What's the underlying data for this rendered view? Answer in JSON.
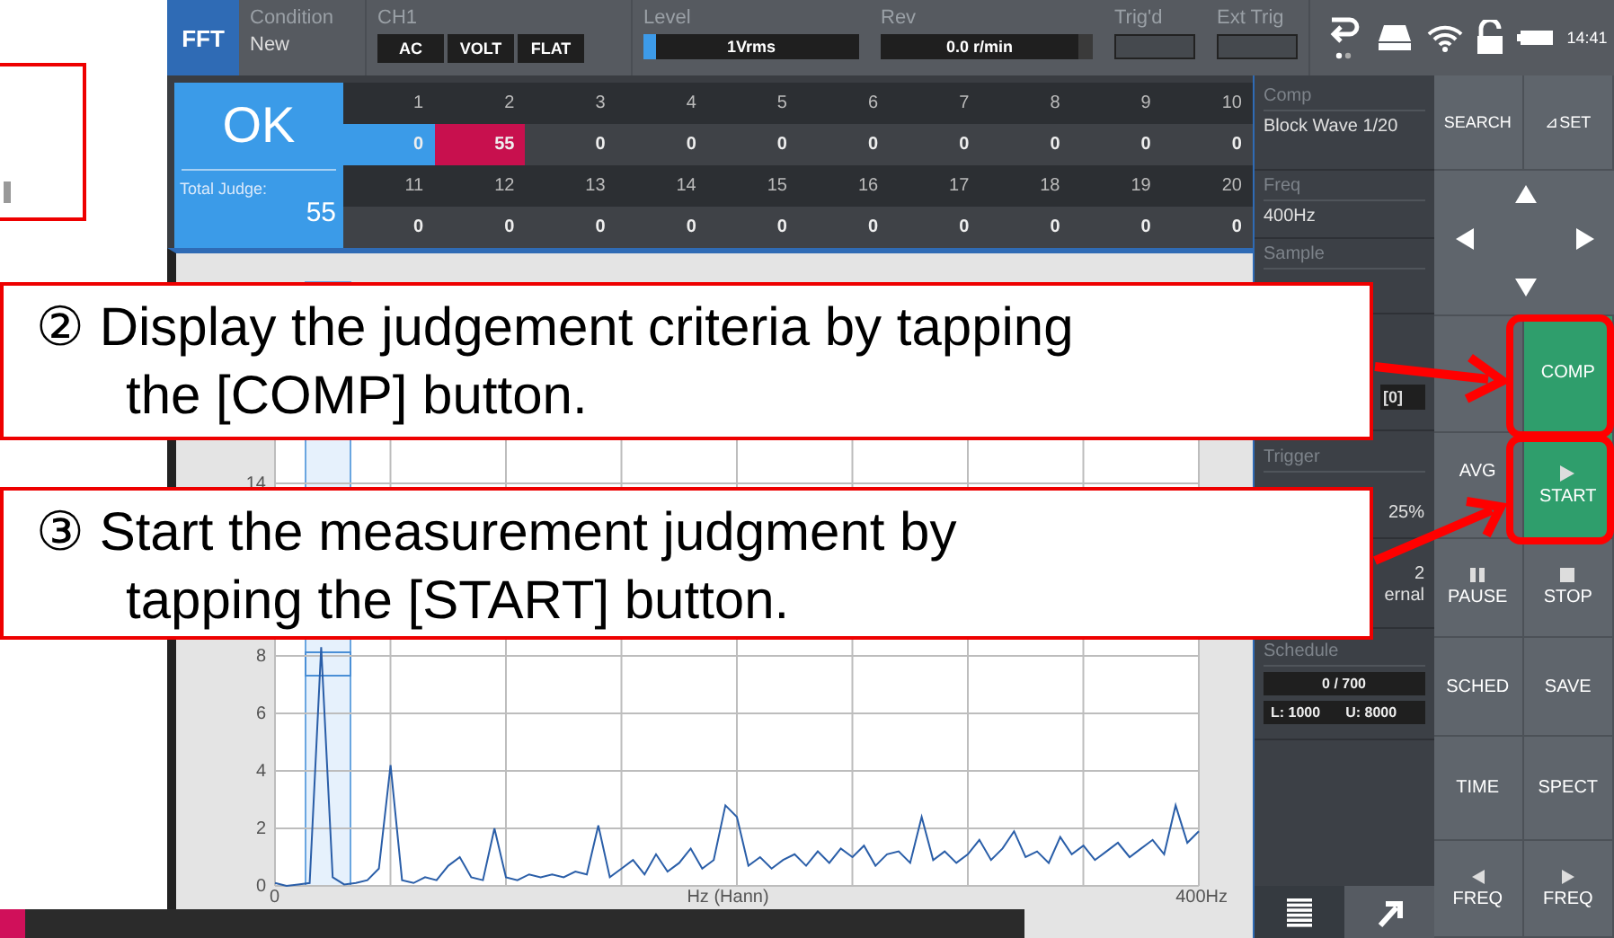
{
  "topbar": {
    "mode": "FFT",
    "condition_label": "Condition",
    "condition_value": "New",
    "channel_label": "CH1",
    "channel_settings": [
      "AC",
      "VOLT",
      "FLAT"
    ],
    "level_label": "Level",
    "level_value": "1Vrms",
    "level_meter": {
      "level": 0.06
    },
    "rev_label": "Rev",
    "rev_value": "0.0 r/min",
    "trigd_label": "Trig'd",
    "ext_trig_label": "Ext Trig",
    "time": "14:41"
  },
  "judge": {
    "result": "OK",
    "total_label": "Total Judge:",
    "total_value": "55",
    "blocks": [
      {
        "number": "1",
        "count": "0",
        "color": "#3b9be8"
      },
      {
        "number": "2",
        "count": "55",
        "color": "#c8104e"
      },
      {
        "number": "3",
        "count": "0",
        "color": "#3f4247"
      },
      {
        "number": "4",
        "count": "0",
        "color": "#3f4247"
      },
      {
        "number": "5",
        "count": "0",
        "color": "#3f4247"
      },
      {
        "number": "6",
        "count": "0",
        "color": "#3f4247"
      },
      {
        "number": "7",
        "count": "0",
        "color": "#3f4247"
      },
      {
        "number": "8",
        "count": "0",
        "color": "#3f4247"
      },
      {
        "number": "9",
        "count": "0",
        "color": "#3f4247"
      },
      {
        "number": "10",
        "count": "0",
        "color": "#3f4247"
      },
      {
        "number": "11",
        "count": "0",
        "color": "#3f4247"
      },
      {
        "number": "12",
        "count": "0",
        "color": "#3f4247"
      },
      {
        "number": "13",
        "count": "0",
        "color": "#3f4247"
      },
      {
        "number": "14",
        "count": "0",
        "color": "#3f4247"
      },
      {
        "number": "15",
        "count": "0",
        "color": "#3f4247"
      },
      {
        "number": "16",
        "count": "0",
        "color": "#3f4247"
      },
      {
        "number": "17",
        "count": "0",
        "color": "#3f4247"
      },
      {
        "number": "18",
        "count": "0",
        "color": "#3f4247"
      },
      {
        "number": "19",
        "count": "0",
        "color": "#3f4247"
      },
      {
        "number": "20",
        "count": "0",
        "color": "#3f4247"
      }
    ]
  },
  "spectrum": {
    "chart_data": {
      "type": "line",
      "xlabel": "Hz (Hann)",
      "xlim": [
        0,
        400
      ],
      "ylim": [
        0,
        21
      ],
      "xticks": [
        {
          "value": 0,
          "label": "0"
        },
        {
          "value": 400,
          "label": "400Hz"
        }
      ],
      "yticks": [
        0,
        2,
        4,
        6,
        8,
        14
      ],
      "grid": true,
      "x": [
        0,
        5,
        10,
        15,
        20,
        25,
        30,
        35,
        40,
        45,
        50,
        55,
        60,
        65,
        70,
        75,
        80,
        85,
        90,
        95,
        100,
        105,
        110,
        115,
        120,
        125,
        130,
        135,
        140,
        145,
        150,
        155,
        160,
        165,
        170,
        175,
        180,
        185,
        190,
        195,
        200,
        205,
        210,
        215,
        220,
        225,
        230,
        235,
        240,
        245,
        250,
        255,
        260,
        265,
        270,
        275,
        280,
        285,
        290,
        295,
        300,
        305,
        310,
        315,
        320,
        325,
        330,
        335,
        340,
        345,
        350,
        355,
        360,
        365,
        370,
        375,
        380,
        385,
        390,
        395,
        400
      ],
      "series": [
        {
          "color": "#2a5ea8",
          "values": [
            0.1,
            0,
            0.05,
            0.1,
            8.3,
            0.3,
            0.05,
            0.1,
            0.2,
            0.6,
            4.2,
            0.2,
            0.1,
            0.3,
            0.2,
            0.7,
            1.0,
            0.3,
            0.2,
            2.0,
            0.3,
            0.2,
            0.4,
            0.3,
            0.4,
            0.3,
            0.5,
            0.4,
            2.1,
            0.3,
            0.6,
            0.9,
            0.4,
            1.1,
            0.5,
            0.8,
            1.3,
            0.6,
            0.9,
            2.8,
            2.4,
            0.7,
            1.0,
            0.6,
            0.9,
            1.1,
            0.7,
            1.2,
            0.8,
            1.3,
            1.0,
            1.4,
            0.7,
            1.1,
            1.2,
            0.8,
            2.4,
            0.9,
            1.2,
            0.8,
            1.1,
            1.6,
            0.9,
            1.3,
            1.9,
            1.0,
            1.2,
            0.8,
            1.7,
            1.1,
            1.4,
            0.9,
            1.2,
            1.5,
            1.0,
            1.3,
            1.6,
            1.1,
            2.8,
            1.5,
            1.9
          ]
        }
      ]
    }
  },
  "info": {
    "comp_label": "Comp",
    "comp_value": "Block Wave  1/20",
    "freq_label": "Freq",
    "freq_value": "400Hz",
    "sample_label": "Sample",
    "field_value": "[0]",
    "trigger_label": "Trigger",
    "trigger_value": "25%",
    "source_lines": [
      "2",
      "ernal"
    ],
    "schedule_label": "Schedule",
    "schedule_count": "0 / 700",
    "schedule_lower": "L: 1000",
    "schedule_upper": "U: 8000"
  },
  "buttons": {
    "top": [
      "SEARCH",
      "⊿SET"
    ],
    "rows": [
      [
        {
          "kind": "plain",
          "accent": false
        },
        {
          "label": "COMP",
          "kind": "plain",
          "accent": true
        }
      ],
      [
        {
          "label": "AVG",
          "kind": "plain",
          "accent": false
        },
        {
          "label": "START",
          "kind": "play",
          "accent": true
        }
      ],
      [
        {
          "label": "PAUSE",
          "kind": "pause",
          "accent": false
        },
        {
          "label": "STOP",
          "kind": "stop",
          "accent": false
        }
      ],
      [
        {
          "label": "SCHED",
          "kind": "plain",
          "accent": false
        },
        {
          "label": "SAVE",
          "kind": "plain",
          "accent": false
        }
      ],
      [
        {
          "label": "TIME",
          "kind": "plain",
          "accent": false
        },
        {
          "label": "SPECT",
          "kind": "plain",
          "accent": false
        }
      ],
      [
        {
          "label": "FREQ",
          "kind": "left",
          "accent": false
        },
        {
          "label": "FREQ",
          "kind": "right",
          "accent": false
        }
      ]
    ]
  },
  "callouts": [
    {
      "lines": [
        "② Display the judgement criteria by tapping",
        "the [COMP] button."
      ]
    },
    {
      "lines": [
        "③ Start the measurement judgment by",
        "tapping the [START] button."
      ]
    }
  ]
}
